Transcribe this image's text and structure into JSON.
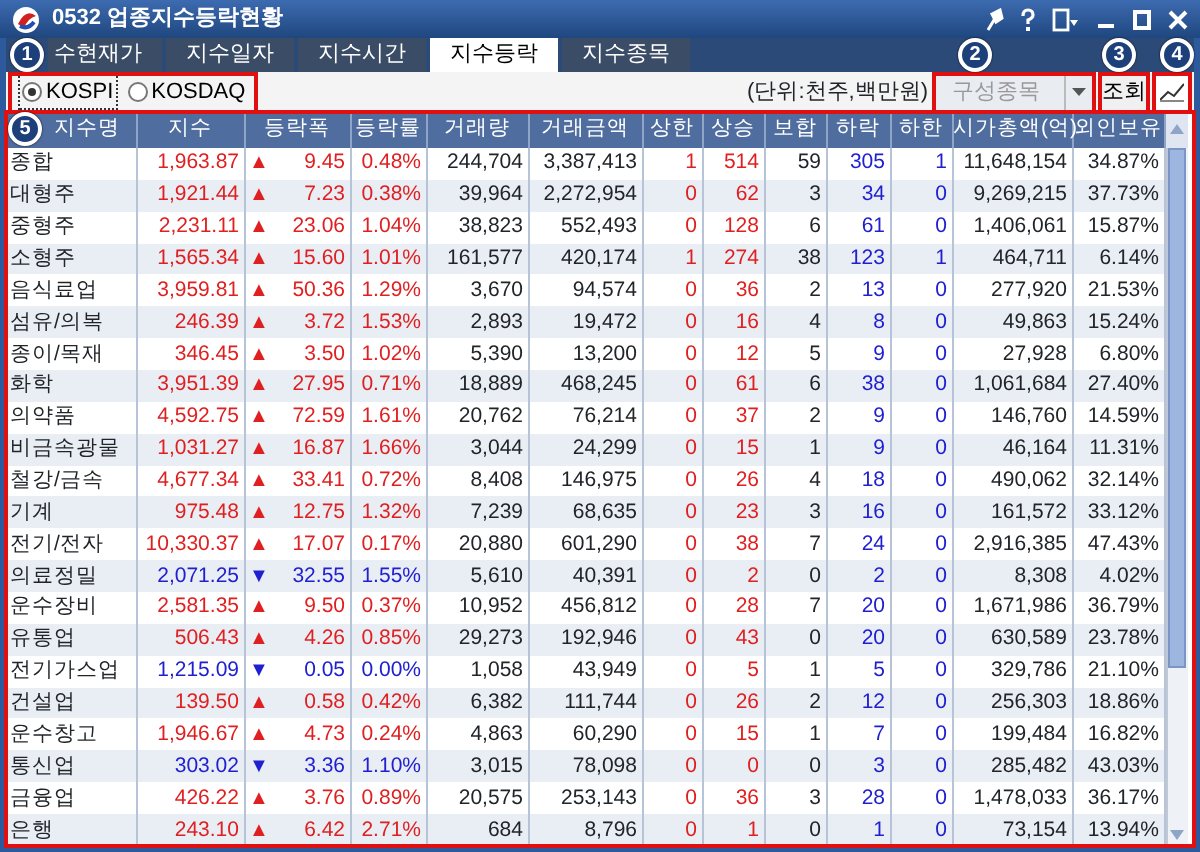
{
  "window": {
    "title": "0532 업종지수등락현황"
  },
  "tabs": [
    {
      "label": "수현재가",
      "selected": false
    },
    {
      "label": "지수일자",
      "selected": false
    },
    {
      "label": "지수시간",
      "selected": false
    },
    {
      "label": "지수등락",
      "selected": true
    },
    {
      "label": "지수종목",
      "selected": false
    }
  ],
  "markets": [
    {
      "label": "KOSPI",
      "selected": true
    },
    {
      "label": "KOSDAQ",
      "selected": false
    }
  ],
  "unit_note": "(단위:천주,백만원)",
  "dropdown": {
    "value": "구성종목",
    "disabled": true
  },
  "query_button": "조회",
  "annotations": [
    {
      "label": "1"
    },
    {
      "label": "2"
    },
    {
      "label": "3"
    },
    {
      "label": "4"
    },
    {
      "label": "5"
    }
  ],
  "table": {
    "columns": [
      "지수명",
      "지수",
      "등락폭",
      "등락률",
      "거래량",
      "거래금액",
      "상한",
      "상승",
      "보합",
      "하락",
      "하한",
      "시가총액(억)",
      "외인보유"
    ],
    "rows": [
      {
        "name": "종합",
        "index": "1,963.87",
        "kind": "up",
        "arrow": "▲",
        "change": "9.45",
        "rate": "0.48%",
        "volume": "244,704",
        "amount": "3,387,413",
        "upper": "1",
        "rise": "514",
        "flat": "59",
        "fall": "305",
        "lower": "1",
        "mcap": "11,648,154",
        "foreign": "34.87%"
      },
      {
        "name": "대형주",
        "index": "1,921.44",
        "kind": "up",
        "arrow": "▲",
        "change": "7.23",
        "rate": "0.38%",
        "volume": "39,964",
        "amount": "2,272,954",
        "upper": "0",
        "rise": "62",
        "flat": "3",
        "fall": "34",
        "lower": "0",
        "mcap": "9,269,215",
        "foreign": "37.73%"
      },
      {
        "name": "중형주",
        "index": "2,231.11",
        "kind": "up",
        "arrow": "▲",
        "change": "23.06",
        "rate": "1.04%",
        "volume": "38,823",
        "amount": "552,493",
        "upper": "0",
        "rise": "128",
        "flat": "6",
        "fall": "61",
        "lower": "0",
        "mcap": "1,406,061",
        "foreign": "15.87%"
      },
      {
        "name": "소형주",
        "index": "1,565.34",
        "kind": "up",
        "arrow": "▲",
        "change": "15.60",
        "rate": "1.01%",
        "volume": "161,577",
        "amount": "420,174",
        "upper": "1",
        "rise": "274",
        "flat": "38",
        "fall": "123",
        "lower": "1",
        "mcap": "464,711",
        "foreign": "6.14%"
      },
      {
        "name": "음식료업",
        "index": "3,959.81",
        "kind": "up",
        "arrow": "▲",
        "change": "50.36",
        "rate": "1.29%",
        "volume": "3,670",
        "amount": "94,574",
        "upper": "0",
        "rise": "36",
        "flat": "2",
        "fall": "13",
        "lower": "0",
        "mcap": "277,920",
        "foreign": "21.53%"
      },
      {
        "name": "섬유/의복",
        "index": "246.39",
        "kind": "up",
        "arrow": "▲",
        "change": "3.72",
        "rate": "1.53%",
        "volume": "2,893",
        "amount": "19,472",
        "upper": "0",
        "rise": "16",
        "flat": "4",
        "fall": "8",
        "lower": "0",
        "mcap": "49,863",
        "foreign": "15.24%"
      },
      {
        "name": "종이/목재",
        "index": "346.45",
        "kind": "up",
        "arrow": "▲",
        "change": "3.50",
        "rate": "1.02%",
        "volume": "5,390",
        "amount": "13,200",
        "upper": "0",
        "rise": "12",
        "flat": "5",
        "fall": "9",
        "lower": "0",
        "mcap": "27,928",
        "foreign": "6.80%"
      },
      {
        "name": "화학",
        "index": "3,951.39",
        "kind": "up",
        "arrow": "▲",
        "change": "27.95",
        "rate": "0.71%",
        "volume": "18,889",
        "amount": "468,245",
        "upper": "0",
        "rise": "61",
        "flat": "6",
        "fall": "38",
        "lower": "0",
        "mcap": "1,061,684",
        "foreign": "27.40%"
      },
      {
        "name": "의약품",
        "index": "4,592.75",
        "kind": "up",
        "arrow": "▲",
        "change": "72.59",
        "rate": "1.61%",
        "volume": "20,762",
        "amount": "76,214",
        "upper": "0",
        "rise": "37",
        "flat": "2",
        "fall": "9",
        "lower": "0",
        "mcap": "146,760",
        "foreign": "14.59%"
      },
      {
        "name": "비금속광물",
        "index": "1,031.27",
        "kind": "up",
        "arrow": "▲",
        "change": "16.87",
        "rate": "1.66%",
        "volume": "3,044",
        "amount": "24,299",
        "upper": "0",
        "rise": "15",
        "flat": "1",
        "fall": "9",
        "lower": "0",
        "mcap": "46,164",
        "foreign": "11.31%"
      },
      {
        "name": "철강/금속",
        "index": "4,677.34",
        "kind": "up",
        "arrow": "▲",
        "change": "33.41",
        "rate": "0.72%",
        "volume": "8,408",
        "amount": "146,975",
        "upper": "0",
        "rise": "26",
        "flat": "4",
        "fall": "18",
        "lower": "0",
        "mcap": "490,062",
        "foreign": "32.14%"
      },
      {
        "name": "기계",
        "index": "975.48",
        "kind": "up",
        "arrow": "▲",
        "change": "12.75",
        "rate": "1.32%",
        "volume": "7,239",
        "amount": "68,635",
        "upper": "0",
        "rise": "23",
        "flat": "3",
        "fall": "16",
        "lower": "0",
        "mcap": "161,572",
        "foreign": "33.12%"
      },
      {
        "name": "전기/전자",
        "index": "10,330.37",
        "kind": "up",
        "arrow": "▲",
        "change": "17.07",
        "rate": "0.17%",
        "volume": "20,880",
        "amount": "601,290",
        "upper": "0",
        "rise": "38",
        "flat": "7",
        "fall": "24",
        "lower": "0",
        "mcap": "2,916,385",
        "foreign": "47.43%"
      },
      {
        "name": "의료정밀",
        "index": "2,071.25",
        "kind": "down",
        "arrow": "▼",
        "change": "32.55",
        "rate": "1.55%",
        "volume": "5,610",
        "amount": "40,391",
        "upper": "0",
        "rise": "2",
        "flat": "0",
        "fall": "2",
        "lower": "0",
        "mcap": "8,308",
        "foreign": "4.02%"
      },
      {
        "name": "운수장비",
        "index": "2,581.35",
        "kind": "up",
        "arrow": "▲",
        "change": "9.50",
        "rate": "0.37%",
        "volume": "10,952",
        "amount": "456,812",
        "upper": "0",
        "rise": "28",
        "flat": "7",
        "fall": "20",
        "lower": "0",
        "mcap": "1,671,986",
        "foreign": "36.79%"
      },
      {
        "name": "유통업",
        "index": "506.43",
        "kind": "up",
        "arrow": "▲",
        "change": "4.26",
        "rate": "0.85%",
        "volume": "29,273",
        "amount": "192,946",
        "upper": "0",
        "rise": "43",
        "flat": "0",
        "fall": "20",
        "lower": "0",
        "mcap": "630,589",
        "foreign": "23.78%"
      },
      {
        "name": "전기가스업",
        "index": "1,215.09",
        "kind": "down",
        "arrow": "▼",
        "change": "0.05",
        "rate": "0.00%",
        "volume": "1,058",
        "amount": "43,949",
        "upper": "0",
        "rise": "5",
        "flat": "1",
        "fall": "5",
        "lower": "0",
        "mcap": "329,786",
        "foreign": "21.10%"
      },
      {
        "name": "건설업",
        "index": "139.50",
        "kind": "up",
        "arrow": "▲",
        "change": "0.58",
        "rate": "0.42%",
        "volume": "6,382",
        "amount": "111,744",
        "upper": "0",
        "rise": "26",
        "flat": "2",
        "fall": "12",
        "lower": "0",
        "mcap": "256,303",
        "foreign": "18.86%"
      },
      {
        "name": "운수창고",
        "index": "1,946.67",
        "kind": "up",
        "arrow": "▲",
        "change": "4.73",
        "rate": "0.24%",
        "volume": "4,863",
        "amount": "60,290",
        "upper": "0",
        "rise": "15",
        "flat": "1",
        "fall": "7",
        "lower": "0",
        "mcap": "199,484",
        "foreign": "16.82%"
      },
      {
        "name": "통신업",
        "index": "303.02",
        "kind": "down",
        "arrow": "▼",
        "change": "3.36",
        "rate": "1.10%",
        "volume": "3,015",
        "amount": "78,098",
        "upper": "0",
        "rise": "0",
        "flat": "0",
        "fall": "3",
        "lower": "0",
        "mcap": "285,482",
        "foreign": "43.03%"
      },
      {
        "name": "금융업",
        "index": "426.22",
        "kind": "up",
        "arrow": "▲",
        "change": "3.76",
        "rate": "0.89%",
        "volume": "20,575",
        "amount": "253,143",
        "upper": "0",
        "rise": "36",
        "flat": "3",
        "fall": "28",
        "lower": "0",
        "mcap": "1,478,033",
        "foreign": "36.17%"
      },
      {
        "name": "은행",
        "index": "243.10",
        "kind": "up",
        "arrow": "▲",
        "change": "6.42",
        "rate": "2.71%",
        "volume": "684",
        "amount": "8,796",
        "upper": "0",
        "rise": "1",
        "flat": "0",
        "fall": "1",
        "lower": "0",
        "mcap": "73,154",
        "foreign": "13.94%"
      }
    ]
  }
}
